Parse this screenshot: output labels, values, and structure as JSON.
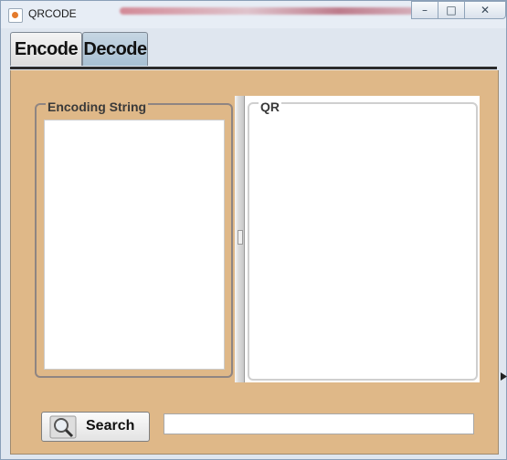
{
  "window": {
    "title": "QRCODE"
  },
  "tabs": [
    {
      "label": "Encode",
      "selected": false
    },
    {
      "label": "Decode",
      "selected": true
    }
  ],
  "encoding_panel": {
    "title": "Encoding String",
    "text": ""
  },
  "qr_panel": {
    "title": "QR"
  },
  "search_button": {
    "label": "Search",
    "icon": "magnifier-icon"
  },
  "path_field": {
    "value": ""
  },
  "window_controls": [
    "minimize-icon",
    "maximize-icon",
    "close-icon"
  ],
  "colors": {
    "content_bg": "#dfb888",
    "selected_tab": "#b6cbdc"
  }
}
